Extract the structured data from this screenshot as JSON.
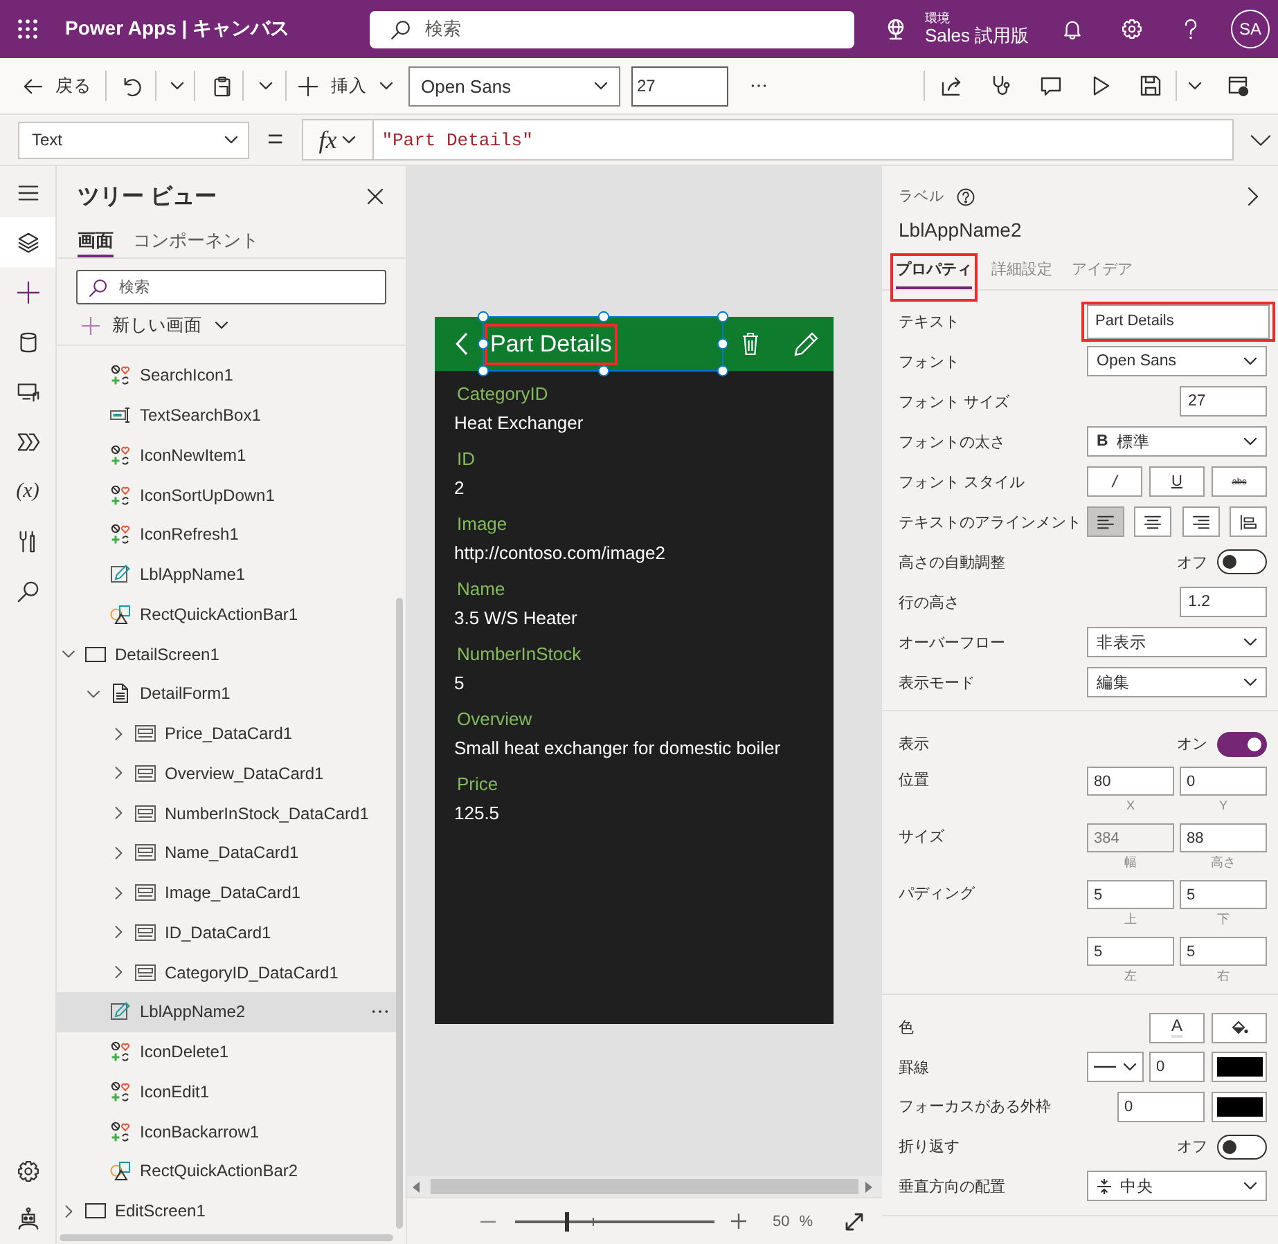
{
  "app_bar": {
    "title": "Power Apps | キャンバス",
    "search": {
      "placeholder": "検索"
    },
    "environment": {
      "caption": "環境",
      "name": "Sales 試用版"
    },
    "avatar": "SA"
  },
  "toolbar": {
    "back": "戻る",
    "insert": "挿入",
    "font": "Open Sans",
    "font_size": "27"
  },
  "formula_bar": {
    "property": "Text",
    "equals": "=",
    "fx": "fx",
    "formula": "\"Part Details\""
  },
  "rail": [
    {
      "kind": "menu",
      "selected": false
    },
    {
      "kind": "tree",
      "selected": true
    },
    {
      "kind": "insert",
      "selected": false
    },
    {
      "kind": "data",
      "selected": false
    },
    {
      "kind": "media",
      "selected": false
    },
    {
      "kind": "automate",
      "selected": false
    },
    {
      "kind": "variables",
      "glyph": "(x)",
      "selected": false
    },
    {
      "kind": "tools",
      "selected": false
    },
    {
      "kind": "search",
      "selected": false
    }
  ],
  "rail_bottom": [
    {
      "kind": "settings",
      "selected": false
    },
    {
      "kind": "copilot",
      "selected": false
    }
  ],
  "tree_view": {
    "title": "ツリー ビュー",
    "tabs": [
      {
        "label": "画面",
        "selected": true
      },
      {
        "label": "コンポーネント",
        "selected": false
      }
    ],
    "search": {
      "placeholder": "検索"
    },
    "new_screen": "新しい画面",
    "items": [
      {
        "children": [
          {
            "label": "SearchIcon1",
            "kind": "icon",
            "selected": false
          },
          {
            "label": "TextSearchBox1",
            "kind": "text-input",
            "selected": false
          },
          {
            "label": "IconNewItem1",
            "kind": "icon",
            "selected": false
          },
          {
            "label": "IconSortUpDown1",
            "kind": "icon",
            "selected": false
          },
          {
            "label": "IconRefresh1",
            "kind": "icon",
            "selected": false
          },
          {
            "label": "LblAppName1",
            "kind": "label",
            "selected": false
          },
          {
            "label": "RectQuickActionBar1",
            "kind": "shape",
            "selected": false
          }
        ]
      },
      {
        "label": "DetailScreen1",
        "kind": "screen",
        "expanded": true,
        "selected": false,
        "children": [
          {
            "label": "DetailForm1",
            "kind": "form",
            "expanded": true,
            "selected": false,
            "children": [
              {
                "label": "Price_DataCard1",
                "kind": "card",
                "expanded": false,
                "selected": false
              },
              {
                "label": "Overview_DataCard1",
                "kind": "card",
                "expanded": false,
                "selected": false
              },
              {
                "label": "NumberInStock_DataCard1",
                "kind": "card",
                "expanded": false,
                "selected": false
              },
              {
                "label": "Name_DataCard1",
                "kind": "card",
                "expanded": false,
                "selected": false
              },
              {
                "label": "Image_DataCard1",
                "kind": "card",
                "expanded": false,
                "selected": false
              },
              {
                "label": "ID_DataCard1",
                "kind": "card",
                "expanded": false,
                "selected": false
              },
              {
                "label": "CategoryID_DataCard1",
                "kind": "card",
                "expanded": false,
                "selected": false
              }
            ]
          },
          {
            "label": "LblAppName2",
            "kind": "label",
            "selected": true
          },
          {
            "label": "IconDelete1",
            "kind": "icon",
            "selected": false
          },
          {
            "label": "IconEdit1",
            "kind": "icon",
            "selected": false
          },
          {
            "label": "IconBackarrow1",
            "kind": "icon",
            "selected": false
          },
          {
            "label": "RectQuickActionBar2",
            "kind": "shape",
            "selected": false
          }
        ]
      },
      {
        "label": "EditScreen1",
        "kind": "screen",
        "expanded": false,
        "selected": false
      }
    ]
  },
  "canvas": {
    "title": {
      "text": "Part Details",
      "highlighted": true
    },
    "fields": [
      {
        "label": "CategoryID",
        "value": "Heat Exchanger"
      },
      {
        "label": "ID",
        "value": "2"
      },
      {
        "label": "Image",
        "value": "http://contoso.com/image2"
      },
      {
        "label": "Name",
        "value": "3.5 W/S Heater"
      },
      {
        "label": "NumberInStock",
        "value": "5"
      },
      {
        "label": "Overview",
        "value": "Small heat exchanger for domestic boiler"
      },
      {
        "label": "Price",
        "value": "125.5"
      }
    ],
    "zoom": {
      "level": 0.26,
      "value": "50",
      "unit": "%"
    }
  },
  "properties": {
    "type": "ラベル",
    "name": "LblAppName2",
    "tabs": [
      {
        "label": "プロパティ",
        "selected": true,
        "highlighted": true
      },
      {
        "label": "詳細設定",
        "selected": false,
        "highlighted": false
      },
      {
        "label": "アイデア",
        "selected": false,
        "highlighted": false
      }
    ],
    "sections": [
      {
        "rows": [
          {
            "kind": "text",
            "label": "テキスト",
            "value": "Part Details",
            "highlighted": true
          },
          {
            "kind": "dropdown",
            "label": "フォント",
            "value": "Open Sans"
          },
          {
            "kind": "number",
            "label": "フォント サイズ",
            "value": "27"
          },
          {
            "kind": "dropdown",
            "label": "フォントの太さ",
            "glyph": "B",
            "value": "標準"
          },
          {
            "kind": "buttons",
            "label": "フォント スタイル",
            "buttons": [
              {
                "kind": "italic",
                "glyph": "/",
                "selected": false
              },
              {
                "kind": "underline",
                "glyph": "U",
                "selected": false
              },
              {
                "kind": "strikethrough",
                "glyph": "abc",
                "selected": false
              }
            ]
          },
          {
            "kind": "align",
            "label": "テキストのアラインメント",
            "buttons": [
              {
                "kind": "left",
                "selected": true
              },
              {
                "kind": "center",
                "selected": false
              },
              {
                "kind": "right",
                "selected": false
              },
              {
                "kind": "justify",
                "selected": false
              }
            ]
          },
          {
            "kind": "toggle",
            "label": "高さの自動調整",
            "state": "オフ",
            "on": false
          },
          {
            "kind": "number",
            "label": "行の高さ",
            "value": "1.2"
          },
          {
            "kind": "dropdown",
            "label": "オーバーフロー",
            "value": "非表示"
          },
          {
            "kind": "dropdown",
            "label": "表示モード",
            "value": "編集"
          }
        ]
      },
      {
        "rows": [
          {
            "kind": "toggle",
            "label": "表示",
            "state": "オン",
            "on": true
          },
          {
            "kind": "pair",
            "label": "位置",
            "fields": [
              {
                "value": "80",
                "caption": "X",
                "disabled": false
              },
              {
                "value": "0",
                "caption": "Y",
                "disabled": false
              }
            ]
          },
          {
            "kind": "pair",
            "label": "サイズ",
            "fields": [
              {
                "value": "384",
                "caption": "幅",
                "disabled": true
              },
              {
                "value": "88",
                "caption": "高さ",
                "disabled": false
              }
            ]
          },
          {
            "kind": "pair",
            "label": "パディング",
            "fields": [
              {
                "value": "5",
                "caption": "上",
                "disabled": false
              },
              {
                "value": "5",
                "caption": "下",
                "disabled": false
              }
            ]
          },
          {
            "kind": "pair",
            "fields": [
              {
                "value": "5",
                "caption": "左",
                "disabled": false
              },
              {
                "value": "5",
                "caption": "右",
                "disabled": false
              }
            ]
          }
        ]
      },
      {
        "rows": [
          {
            "kind": "buttons",
            "label": "色",
            "buttons": [
              {
                "kind": "text-color",
                "glyph": "A",
                "selected": false
              },
              {
                "kind": "fill",
                "selected": false
              }
            ]
          },
          {
            "kind": "border",
            "label": "罫線",
            "value": "0",
            "color": "#000000"
          },
          {
            "kind": "swatch",
            "label": "フォーカスがある外枠",
            "value": "0",
            "color": "#000000"
          },
          {
            "kind": "toggle",
            "label": "折り返す",
            "state": "オフ",
            "on": false
          },
          {
            "kind": "valign",
            "label": "垂直方向の配置",
            "value": "中央"
          }
        ]
      }
    ]
  }
}
